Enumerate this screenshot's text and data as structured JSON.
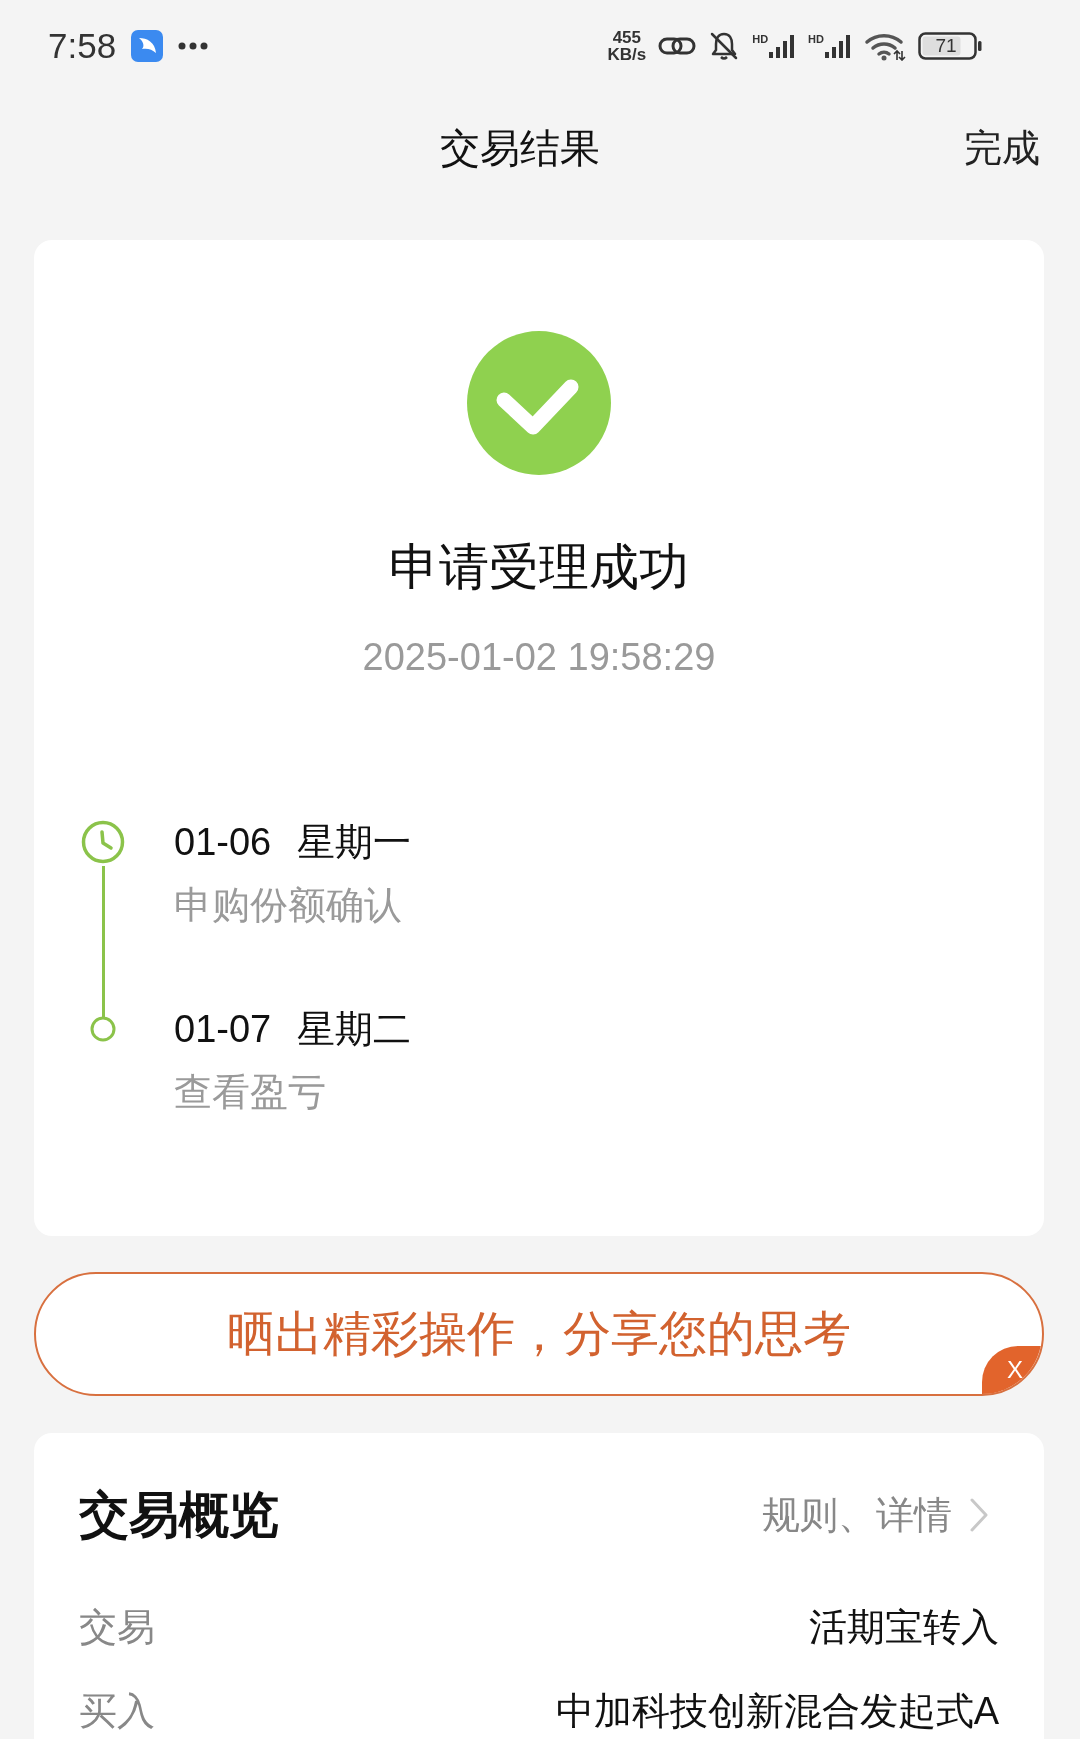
{
  "status_bar": {
    "time": "7:58",
    "speed_value": "455",
    "speed_unit": "KB/s",
    "signals": [
      {
        "label": "HD"
      },
      {
        "label": "HD"
      }
    ],
    "battery": "71"
  },
  "nav": {
    "title": "交易结果",
    "action": "完成"
  },
  "result": {
    "title": "申请受理成功",
    "time": "2025-01-02 19:58:29"
  },
  "timeline": [
    {
      "kind": "clock",
      "date": "01-06",
      "weekday": "星期一",
      "label": "申购份额确认"
    },
    {
      "kind": "dot",
      "date": "01-07",
      "weekday": "星期二",
      "label": "查看盈亏"
    }
  ],
  "share_banner": {
    "text": "晒出精彩操作，分享您的思考",
    "close": "X"
  },
  "overview": {
    "title": "交易概览",
    "link": "规则、详情",
    "rows": [
      {
        "label": "交易",
        "value": "活期宝转入"
      },
      {
        "label": "买入",
        "value": "中加科技创新混合发起式A"
      }
    ]
  }
}
